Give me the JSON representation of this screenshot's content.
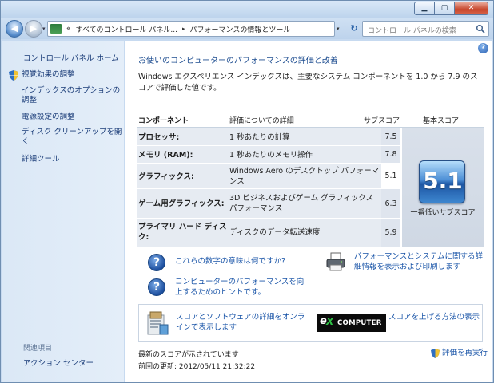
{
  "window": {
    "caption_buttons": {
      "minimize": "▁",
      "maximize": "▢",
      "close": "✕"
    }
  },
  "navbar": {
    "history": "▾",
    "breadcrumb_prefix": "«",
    "breadcrumb": [
      "すべてのコントロール パネル...",
      "パフォーマンスの情報とツール"
    ],
    "separator": "▸",
    "dropdown": "▾",
    "refresh": "↻",
    "search_placeholder": "コントロール パネルの検索"
  },
  "sidebar": {
    "home": "コントロール パネル ホーム",
    "items": [
      "視覚効果の調整",
      "インデックスのオプションの調整",
      "電源設定の調整",
      "ディスク クリーンアップを開く",
      "詳細ツール"
    ],
    "related_title": "関連項目",
    "related_items": [
      "アクション センター"
    ]
  },
  "main": {
    "help": "?",
    "heading": "お使いのコンピューターのパフォーマンスの評価と改善",
    "intro": "Windows エクスペリエンス インデックスは、主要なシステム コンポーネントを 1.0 から 7.9 のスコアで評価した値です。",
    "table_headers": {
      "component": "コンポーネント",
      "details": "評価についての詳細",
      "subscore": "サブスコア",
      "base": "基本スコア"
    },
    "rows": [
      {
        "name": "プロセッサ:",
        "desc": "1 秒あたりの計算",
        "score": "7.5"
      },
      {
        "name": "メモリ (RAM):",
        "desc": "1 秒あたりのメモリ操作",
        "score": "7.8"
      },
      {
        "name": "グラフィックス:",
        "desc": "Windows Aero のデスクトップ パフォーマンス",
        "score": "5.1"
      },
      {
        "name": "ゲーム用グラフィックス:",
        "desc": "3D ビジネスおよびゲーム グラフィックス パフォーマンス",
        "score": "6.3"
      },
      {
        "name": "プライマリ ハード ディスク:",
        "desc": "ディスクのデータ転送速度",
        "score": "5.9"
      }
    ],
    "base_score": "5.1",
    "base_label": "一番低いサブスコア",
    "links": {
      "meaning": "これらの数字の意味は何ですか?",
      "tips": "コンピューターのパフォーマンスを向上するためのヒントです。",
      "print": "パフォーマンスとシステムに関する詳細情報を表示および印刷します",
      "online": "スコアとソフトウェアの詳細をオンラインで表示します",
      "raise": "スコアを上げる方法の表示"
    },
    "logo": {
      "e": "e",
      "x": "X",
      "computer": "COMPUTER"
    },
    "status": "最新のスコアが示されています",
    "last_update": "前回の更新: 2012/05/11 21:32:22",
    "rerun": "評価を再実行"
  }
}
